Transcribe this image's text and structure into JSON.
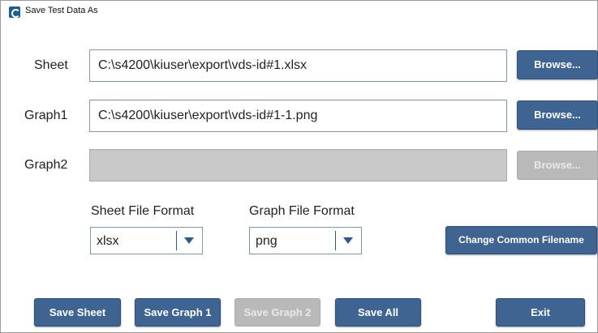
{
  "window": {
    "title": "Save Test Data As"
  },
  "rows": [
    {
      "label": "Sheet",
      "value": "C:\\s4200\\kiuser\\export\\vds-id#1.xlsx",
      "button": "Browse..."
    },
    {
      "label": "Graph1",
      "value": "C:\\s4200\\kiuser\\export\\vds-id#1-1.png",
      "button": "Browse..."
    },
    {
      "label": "Graph2",
      "value": "",
      "button": "Browse..."
    }
  ],
  "formats": {
    "sheet_label": "Sheet File Format",
    "sheet_value": "xlsx",
    "graph_label": "Graph File Format",
    "graph_value": "png",
    "change_button": "Change Common Filename"
  },
  "actions": {
    "save_sheet": "Save Sheet",
    "save_graph1": "Save Graph 1",
    "save_graph2": "Save Graph 2",
    "save_all": "Save All",
    "exit": "Exit"
  },
  "icons": {
    "app": "app-logo-icon",
    "dropdown": "chevron-down-icon"
  },
  "colors": {
    "button_bg": "#3f6491",
    "button_disabled_bg": "#b9b9b9",
    "field_border": "#7f96ad",
    "field_disabled_bg": "#c9c9c9"
  }
}
